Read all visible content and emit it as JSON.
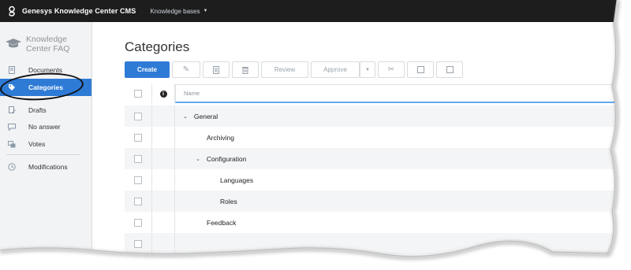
{
  "topbar": {
    "app_title": "Genesys Knowledge Center CMS",
    "kb_menu_label": "Knowledge bases",
    "logo_icon": "genesys-logo-icon",
    "caret_icon": "caret-down-icon"
  },
  "sidebar": {
    "brand_line1": "Knowledge",
    "brand_line2": "Center FAQ",
    "brand_icon": "graduation-cap-icon",
    "items": [
      {
        "label": "Documents",
        "icon": "document-icon",
        "active": false
      },
      {
        "label": "Categories",
        "icon": "tag-icon",
        "active": true
      },
      {
        "label": "Drafts",
        "icon": "drafts-icon",
        "active": false
      },
      {
        "label": "No answer",
        "icon": "chat-icon",
        "active": false
      },
      {
        "label": "Votes",
        "icon": "votes-icon",
        "active": false
      },
      {
        "label": "Modifications",
        "icon": "history-icon",
        "active": false
      }
    ]
  },
  "main": {
    "page_title": "Categories",
    "toolbar": {
      "create_label": "Create",
      "review_label": "Review",
      "approve_label": "Approve"
    },
    "table": {
      "name_header": "Name",
      "rows": [
        {
          "label": "General",
          "expanded": true
        },
        {
          "label": "Archiving"
        },
        {
          "label": "Configuration",
          "expanded": true
        },
        {
          "label": "Languages"
        },
        {
          "label": "Roles"
        },
        {
          "label": "Feedback"
        }
      ]
    }
  },
  "colors": {
    "accent": "#2e7bd6",
    "topbar": "#1d1d1d",
    "sidebar": "#f2f3f4",
    "header_underline": "#64a9f0"
  }
}
